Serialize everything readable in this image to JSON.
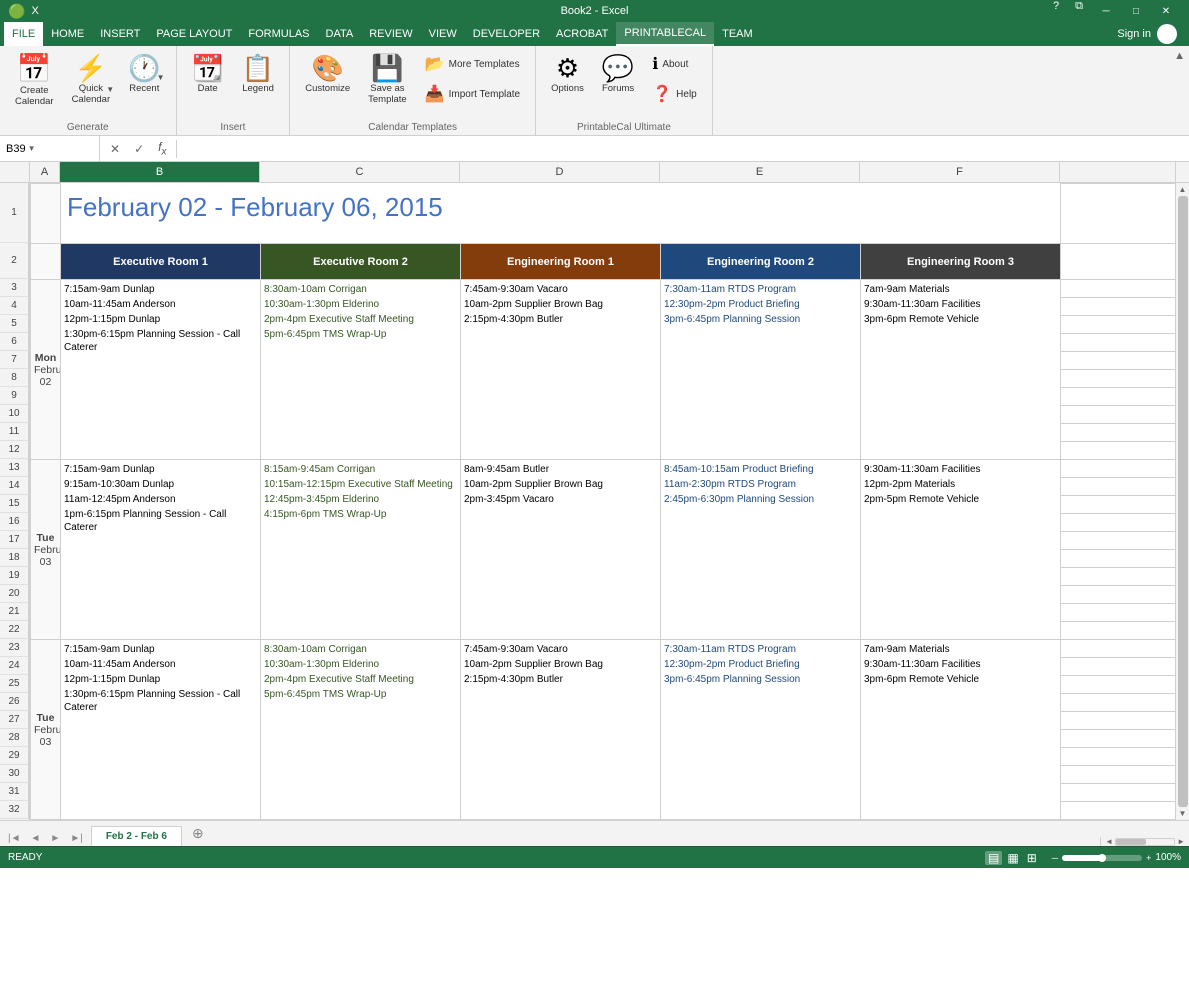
{
  "titlebar": {
    "filename": "Book2 - Excel",
    "help_icon": "?",
    "restore_icon": "⧉",
    "minimize_icon": "─",
    "maximize_icon": "□",
    "close_icon": "✕"
  },
  "menubar": {
    "items": [
      "FILE",
      "HOME",
      "INSERT",
      "PAGE LAYOUT",
      "FORMULAS",
      "DATA",
      "REVIEW",
      "VIEW",
      "DEVELOPER",
      "ACROBAT",
      "PRINTABLECAL",
      "TEAM"
    ],
    "active": "PRINTABLECAL",
    "signin": "Sign in"
  },
  "ribbon": {
    "groups": [
      {
        "label": "Generate",
        "buttons": [
          {
            "id": "create-calendar",
            "icon": "📅",
            "label": "Create\nCalendar"
          },
          {
            "id": "quick-calendar",
            "icon": "⚡",
            "label": "Quick\nCalendar"
          },
          {
            "id": "recent",
            "icon": "🕐",
            "label": "Recent"
          }
        ]
      },
      {
        "label": "Insert",
        "buttons": [
          {
            "id": "date",
            "icon": "📆",
            "label": "Date"
          },
          {
            "id": "legend",
            "icon": "📋",
            "label": "Legend"
          }
        ]
      },
      {
        "label": "Calendar Templates",
        "buttons": [
          {
            "id": "customize",
            "icon": "🎨",
            "label": "Customize"
          },
          {
            "id": "save-as-template",
            "icon": "💾",
            "label": "Save as\nTemplate"
          }
        ],
        "small_buttons": [
          {
            "id": "more-templates",
            "icon": "📂",
            "label": "More Templates"
          },
          {
            "id": "import-template",
            "icon": "📥",
            "label": "Import Template"
          }
        ]
      },
      {
        "label": "PrintableCal Ultimate",
        "buttons": [
          {
            "id": "options",
            "icon": "⚙",
            "label": "Options"
          },
          {
            "id": "forums",
            "icon": "💬",
            "label": "Forums"
          }
        ],
        "small_buttons": [
          {
            "id": "about",
            "icon": "ℹ",
            "label": "About"
          },
          {
            "id": "help",
            "icon": "❓",
            "label": "Help"
          }
        ]
      }
    ]
  },
  "formula_bar": {
    "name_box": "B39",
    "formula": ""
  },
  "columns": {
    "headers": [
      "",
      "A",
      "B",
      "C",
      "D",
      "E",
      "F"
    ],
    "widths": [
      30,
      30,
      200,
      200,
      200,
      200,
      200
    ]
  },
  "calendar": {
    "title": "February 02 - February 06, 2015",
    "rooms": [
      {
        "name": "Executive Room 1",
        "bg": "#1F3864"
      },
      {
        "name": "Executive Room 2",
        "bg": "#375623"
      },
      {
        "name": "Engineering Room 1",
        "bg": "#843C0C"
      },
      {
        "name": "Engineering Room 2",
        "bg": "#1F497D"
      },
      {
        "name": "Engineering Room 3",
        "bg": "#404040"
      }
    ],
    "days": [
      {
        "day_name": "Mon",
        "month": "February",
        "date": "02",
        "rows": 10,
        "events": {
          "exec1": [
            {
              "text": "7:15am-9am Dunlap",
              "color": "black"
            },
            {
              "text": "10am-11:45am Anderson",
              "color": "black"
            },
            {
              "text": "12pm-1:15pm Dunlap",
              "color": "black"
            },
            {
              "text": "1:30pm-6:15pm Planning Session - Call Caterer",
              "color": "black"
            }
          ],
          "exec2": [
            {
              "text": "8:30am-10am Corrigan",
              "color": "green"
            },
            {
              "text": "10:30am-1:30pm Elderino",
              "color": "green"
            },
            {
              "text": "2pm-4pm Executive Staff Meeting",
              "color": "green"
            },
            {
              "text": "5pm-6:45pm TMS Wrap-Up",
              "color": "green"
            }
          ],
          "eng1": [
            {
              "text": "7:45am-9:30am Vacaro",
              "color": "black"
            },
            {
              "text": "10am-2pm Supplier Brown Bag",
              "color": "black"
            },
            {
              "text": "2:15pm-4:30pm Butler",
              "color": "black"
            }
          ],
          "eng2": [
            {
              "text": "7:30am-11am RTDS Program",
              "color": "blue"
            },
            {
              "text": "12:30pm-2pm Product Briefing",
              "color": "blue"
            },
            {
              "text": "3pm-6:45pm Planning Session",
              "color": "blue"
            }
          ],
          "eng3": [
            {
              "text": "7am-9am Materials",
              "color": "black"
            },
            {
              "text": "9:30am-11:30am Facilities",
              "color": "black"
            },
            {
              "text": "3pm-6pm Remote Vehicle",
              "color": "black"
            }
          ]
        }
      },
      {
        "day_name": "Tue",
        "month": "February",
        "date": "03",
        "rows": 10,
        "events": {
          "exec1": [
            {
              "text": "7:15am-9am Dunlap",
              "color": "black"
            },
            {
              "text": "9:15am-10:30am Dunlap",
              "color": "black"
            },
            {
              "text": "11am-12:45pm Anderson",
              "color": "black"
            },
            {
              "text": "1pm-6:15pm Planning Session - Call Caterer",
              "color": "black"
            }
          ],
          "exec2": [
            {
              "text": "8:15am-9:45am Corrigan",
              "color": "green"
            },
            {
              "text": "10:15am-12:15pm Executive Staff Meeting",
              "color": "green"
            },
            {
              "text": "12:45pm-3:45pm Elderino",
              "color": "green"
            },
            {
              "text": "4:15pm-6pm TMS Wrap-Up",
              "color": "green"
            }
          ],
          "eng1": [
            {
              "text": "8am-9:45am Butler",
              "color": "black"
            },
            {
              "text": "10am-2pm Supplier Brown Bag",
              "color": "black"
            },
            {
              "text": "2pm-3:45pm Vacaro",
              "color": "black"
            }
          ],
          "eng2": [
            {
              "text": "8:45am-10:15am Product Briefing",
              "color": "blue"
            },
            {
              "text": "11am-2:30pm RTDS Program",
              "color": "blue"
            },
            {
              "text": "2:45pm-6:30pm Planning Session",
              "color": "blue"
            }
          ],
          "eng3": [
            {
              "text": "9:30am-11:30am Facilities",
              "color": "black"
            },
            {
              "text": "12pm-2pm Materials",
              "color": "black"
            },
            {
              "text": "2pm-5pm Remote Vehicle",
              "color": "black"
            }
          ]
        }
      },
      {
        "day_name": "Tue",
        "month": "February",
        "date": "03",
        "rows": 10,
        "events": {
          "exec1": [
            {
              "text": "7:15am-9am Dunlap",
              "color": "black"
            },
            {
              "text": "10am-11:45am Anderson",
              "color": "black"
            },
            {
              "text": "12pm-1:15pm Dunlap",
              "color": "black"
            },
            {
              "text": "1:30pm-6:15pm Planning Session - Call Caterer",
              "color": "black"
            }
          ],
          "exec2": [
            {
              "text": "8:30am-10am Corrigan",
              "color": "green"
            },
            {
              "text": "10:30am-1:30pm Elderino",
              "color": "green"
            },
            {
              "text": "2pm-4pm Executive Staff Meeting",
              "color": "green"
            },
            {
              "text": "5pm-6:45pm TMS Wrap-Up",
              "color": "green"
            }
          ],
          "eng1": [
            {
              "text": "7:45am-9:30am Vacaro",
              "color": "black"
            },
            {
              "text": "10am-2pm Supplier Brown Bag",
              "color": "black"
            },
            {
              "text": "2:15pm-4:30pm Butler",
              "color": "black"
            }
          ],
          "eng2": [
            {
              "text": "7:30am-11am RTDS Program",
              "color": "blue"
            },
            {
              "text": "12:30pm-2pm Product Briefing",
              "color": "blue"
            },
            {
              "text": "3pm-6:45pm Planning Session",
              "color": "blue"
            }
          ],
          "eng3": [
            {
              "text": "7am-9am Materials",
              "color": "black"
            },
            {
              "text": "9:30am-11:30am Facilities",
              "color": "black"
            },
            {
              "text": "3pm-6pm Remote Vehicle",
              "color": "black"
            }
          ]
        }
      }
    ]
  },
  "rows": [
    1,
    2,
    3,
    4,
    5,
    6,
    7,
    8,
    9,
    10,
    11,
    12,
    13,
    14,
    15,
    16,
    17,
    18,
    19,
    20,
    21,
    22,
    23,
    24,
    25,
    26,
    27,
    28,
    29,
    30,
    31,
    32
  ],
  "sheet_tabs": [
    "Feb 2 - Feb 6"
  ],
  "status": {
    "ready": "READY",
    "zoom": "100%"
  }
}
